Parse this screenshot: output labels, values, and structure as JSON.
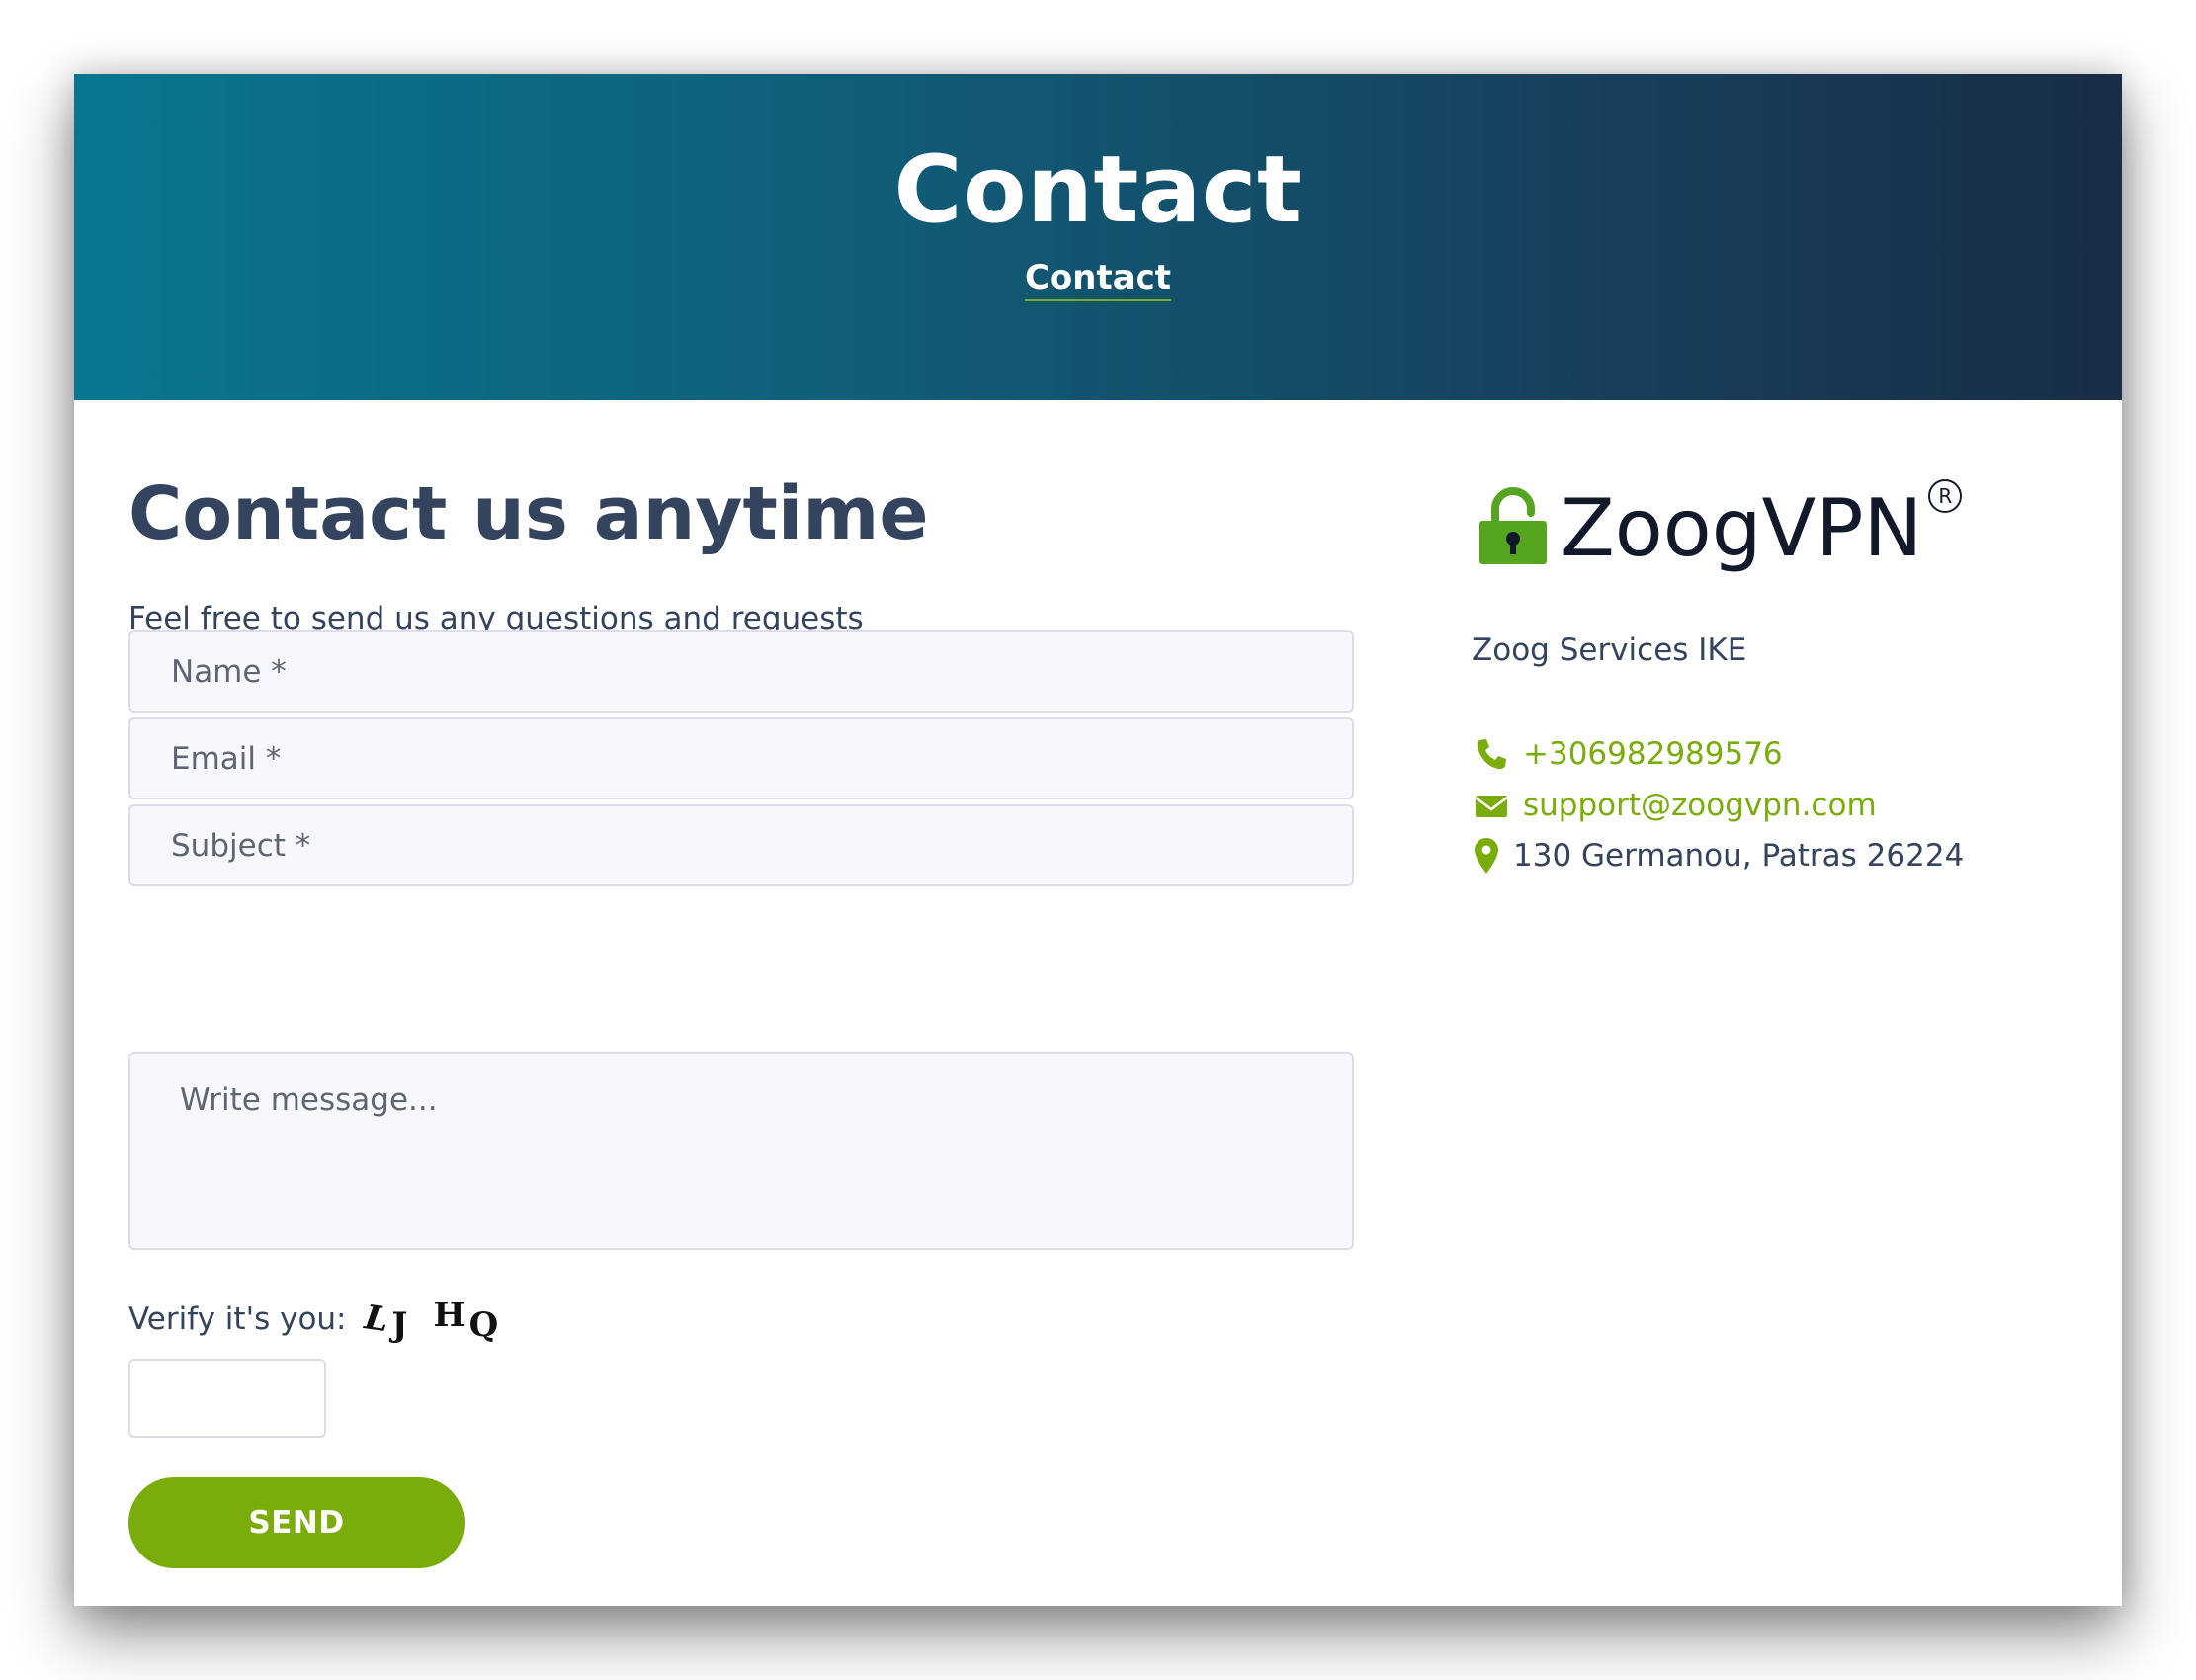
{
  "hero": {
    "title": "Contact",
    "breadcrumb": "Contact"
  },
  "form": {
    "heading": "Contact us anytime",
    "subtext": "Feel free to send us any questions and requests",
    "name_placeholder": "Name *",
    "email_placeholder": "Email *",
    "subject_placeholder": "Subject *",
    "message_placeholder": "Write message...",
    "verify_label": "Verify it's you:",
    "captcha": [
      "L",
      "J",
      "H",
      "Q"
    ],
    "send_label": "SEND"
  },
  "sidebar": {
    "logo_text": "ZoogVPN",
    "company": "Zoog Services IKE",
    "phone": "+306982989576",
    "email": "support@zoogvpn.com",
    "address": "130 Germanou, Patras 26224"
  },
  "colors": {
    "accent": "#7aad0c",
    "heading": "#34435e",
    "hero_start": "#08768f",
    "hero_end": "#182d47"
  },
  "icons": [
    "lock-icon",
    "registered-icon",
    "phone-icon",
    "envelope-icon",
    "map-pin-icon"
  ]
}
